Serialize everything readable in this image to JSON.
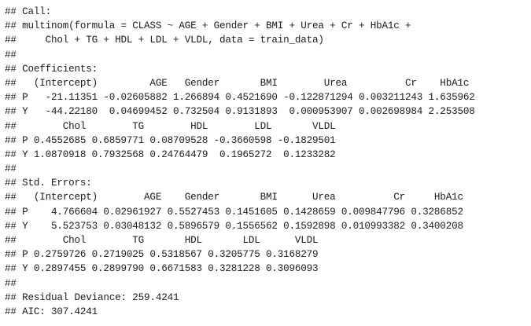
{
  "console": {
    "lines": [
      "## Call:",
      "## multinom(formula = CLASS ~ AGE + Gender + BMI + Urea + Cr + HbA1c +",
      "##     Chol + TG + HDL + LDL + VLDL, data = train_data)",
      "##",
      "## Coefficients:",
      "##   (Intercept)         AGE   Gender       BMI        Urea          Cr    HbA1c",
      "## P   -21.11351 -0.02605882 1.266894 0.4521690 -0.122871294 0.003211243 1.635962",
      "## Y   -44.22180  0.04699452 0.732504 0.9131893  0.000953907 0.002698984 2.253508",
      "##        Chol        TG        HDL        LDL       VLDL",
      "## P 0.4552685 0.6859771 0.08709528 -0.3660598 -0.1829501",
      "## Y 1.0870918 0.7932568 0.24764479  0.1965272  0.1233282",
      "##",
      "## Std. Errors:",
      "##   (Intercept)        AGE    Gender       BMI      Urea          Cr     HbA1c",
      "## P    4.766604 0.02961927 0.5527453 0.1451605 0.1428659 0.009847796 0.3286852",
      "## Y    5.523753 0.03048132 0.5896579 0.1556562 0.1592898 0.010993382 0.3400208",
      "##        Chol        TG       HDL       LDL      VLDL",
      "## P 0.2759726 0.2719025 0.5318567 0.3205775 0.3168279",
      "## Y 0.2897455 0.2899790 0.6671583 0.3281228 0.3096093",
      "##",
      "## Residual Deviance: 259.4241",
      "## AIC: 307.4241"
    ]
  }
}
